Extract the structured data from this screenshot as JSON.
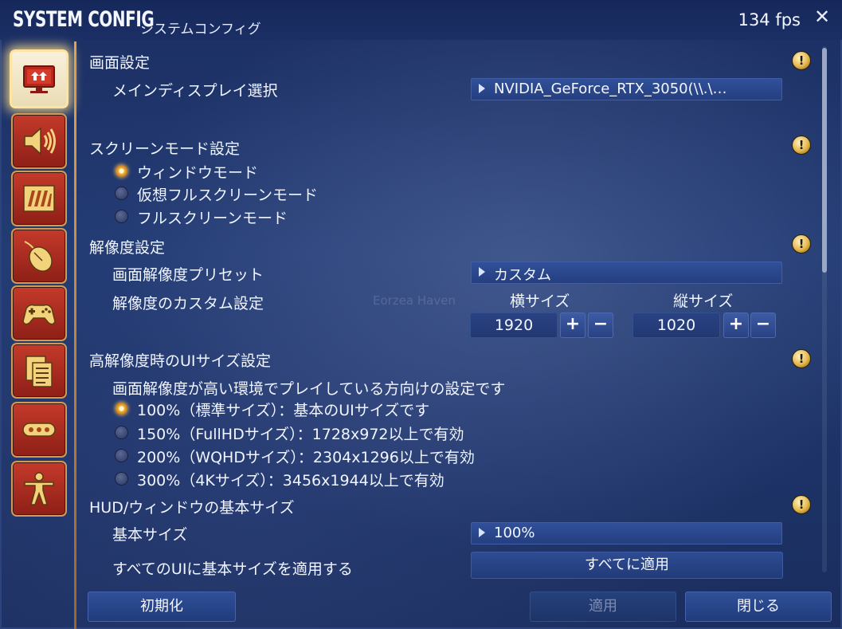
{
  "window": {
    "title": "SYSTEM CONFIG",
    "subtitle": "システムコンフィグ",
    "fps": "134 fps",
    "close_icon": "close-icon"
  },
  "sidebar": {
    "items": [
      {
        "name": "display-settings",
        "icon": "monitor-icon",
        "active": true
      },
      {
        "name": "sound-settings",
        "icon": "speaker-icon",
        "active": false
      },
      {
        "name": "graphics-settings",
        "icon": "graphics-icon",
        "active": false
      },
      {
        "name": "mouse-settings",
        "icon": "mouse-icon",
        "active": false
      },
      {
        "name": "gamepad-settings",
        "icon": "gamepad-icon",
        "active": false
      },
      {
        "name": "other-settings",
        "icon": "document-icon",
        "active": false
      },
      {
        "name": "more-settings",
        "icon": "ellipsis-icon",
        "active": false
      },
      {
        "name": "accessibility-settings",
        "icon": "person-icon",
        "active": false
      }
    ]
  },
  "watermark": "Eorzea Haven",
  "sections": {
    "screen": {
      "title": "画面設定",
      "main_display_label": "メインディスプレイ選択",
      "main_display_value": "NVIDIA_GeForce_RTX_3050(\\\\.\\…"
    },
    "screen_mode": {
      "title": "スクリーンモード設定",
      "options": [
        "ウィンドウモード",
        "仮想フルスクリーンモード",
        "フルスクリーンモード"
      ],
      "selected": 0
    },
    "resolution": {
      "title": "解像度設定",
      "preset_label": "画面解像度プリセット",
      "preset_value": "カスタム",
      "custom_label": "解像度のカスタム設定",
      "width_label": "横サイズ",
      "height_label": "縦サイズ",
      "width_value": "1920",
      "height_value": "1020",
      "plus": "+",
      "minus": "−"
    },
    "ui_size": {
      "title": "高解像度時のUIサイズ設定",
      "description": "画面解像度が高い環境でプレイしている方向けの設定です",
      "options": [
        "100%（標準サイズ）：基本のUIサイズです",
        "150%（FullHDサイズ）：1728x972以上で有効",
        "200%（WQHDサイズ）：2304x1296以上で有効",
        "300%（4Kサイズ）：3456x1944以上で有効"
      ],
      "selected": 0
    },
    "hud": {
      "title": "HUD/ウィンドウの基本サイズ",
      "base_size_label": "基本サイズ",
      "base_size_value": "100%",
      "apply_all_label": "すべてのUIに基本サイズを適用する",
      "apply_all_button": "すべてに適用"
    }
  },
  "footer": {
    "reset": "初期化",
    "apply": "適用",
    "close": "閉じる"
  },
  "colors": {
    "accent_gold": "#e2a24a",
    "sidebar_red": "#c43a2a",
    "panel_blue": "#213a72"
  }
}
